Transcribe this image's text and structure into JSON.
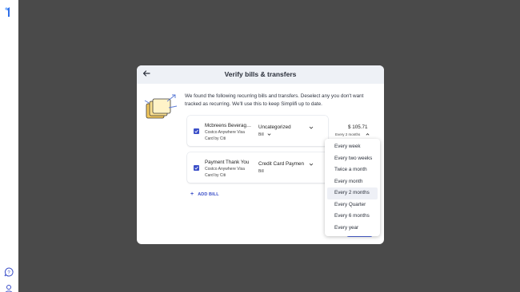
{
  "app": {
    "logo": "simplifi-logo",
    "help": "help-icon",
    "user": "user-icon"
  },
  "modal": {
    "title": "Verify bills & transfers",
    "intro": "We found the following recurring bills and transfers. Deselect any you don't want tracked as recurring. We'll use this to keep Simplifi up to date."
  },
  "bills": [
    {
      "payee": "Mcbreens Beverag…",
      "account": "Costco Anywhere Visa Card by Citi",
      "category": "Uncategorized",
      "type": "Bill",
      "amount": "$ 105.71",
      "frequency": "Every 2 months",
      "checked": true
    },
    {
      "payee": "Payment Thank You",
      "account": "Costco Anywhere Visa Card by Citi",
      "category": "Credit Card Paymen",
      "type": "Bill",
      "checked": true
    }
  ],
  "add_bill_label": "ADD BILL",
  "frequency_dropdown": {
    "options": [
      "Every week",
      "Every two weeks",
      "Twice a month",
      "Every month",
      "Every 2 months",
      "Every Quarter",
      "Every 6 months",
      "Every year"
    ],
    "selected": "Every 2 months"
  },
  "colors": {
    "accent": "#3b4fc8",
    "overlay": "#4a4a4a",
    "header": "#eef1f6"
  }
}
